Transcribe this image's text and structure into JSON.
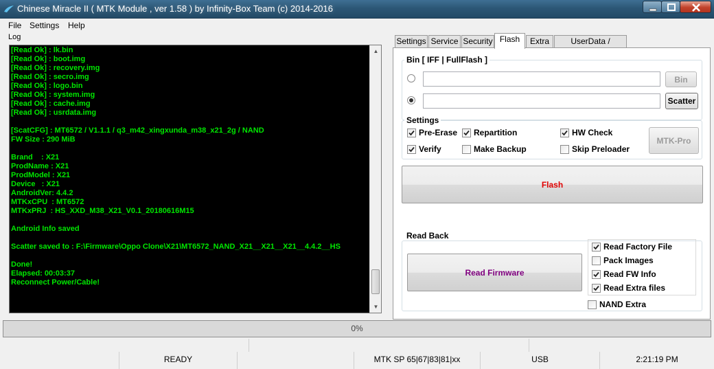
{
  "window": {
    "title": "Chinese Miracle II ( MTK Module , ver 1.58 ) by Infinity-Box Team (c) 2014-2016",
    "controls": [
      "minimize-icon",
      "maximize-icon",
      "close-icon"
    ],
    "accent_color": "#2c5776"
  },
  "menu": [
    "File",
    "Settings",
    "Help"
  ],
  "log": {
    "label": "Log",
    "text_color": "#00e600",
    "lines": [
      "[Read Ok] : lk.bin",
      "[Read Ok] : boot.img",
      "[Read Ok] : recovery.img",
      "[Read Ok] : secro.img",
      "[Read Ok] : logo.bin",
      "[Read Ok] : system.img",
      "[Read Ok] : cache.img",
      "[Read Ok] : usrdata.img",
      "",
      "[ScatCFG] : MT6572 / V1.1.1 / q3_m42_xingxunda_m38_x21_2g / NAND",
      "FW Size : 290 MiB",
      "",
      "Brand    : X21",
      "ProdName : X21",
      "ProdModel : X21",
      "Device   : X21",
      "AndroidVer: 4.4.2",
      "MTKxCPU  : MT6572",
      "MTKxPRJ  : HS_XXD_M38_X21_V0.1_20180616M15",
      "",
      "Android Info saved",
      "",
      "Scatter saved to : F:\\Firmware\\Oppo Clone\\X21\\MT6572_NAND_X21__X21__X21__4.4.2__HS",
      "",
      "Done!",
      "Elapsed: 00:03:37",
      "Reconnect Power/Cable!"
    ]
  },
  "tabs": [
    "Settings",
    "Service",
    "Security",
    "Flash",
    "Extra",
    "UserData / Forensic"
  ],
  "active_tab": "Flash",
  "flash": {
    "bin_group_title": "Bin  [ IFF | FullFlash ]",
    "bin_radio_selected": false,
    "scatter_radio_selected": true,
    "bin_path": "",
    "scatter_path": "",
    "bin_button": "Bin",
    "scatter_button": "Scatter",
    "settings_title": "Settings",
    "options": [
      {
        "label": "Pre-Erase",
        "checked": true
      },
      {
        "label": "Repartition",
        "checked": true
      },
      {
        "label": "HW Check",
        "checked": true
      },
      {
        "label": "Verify",
        "checked": true
      },
      {
        "label": "Make Backup",
        "checked": false
      },
      {
        "label": "Skip Preloader",
        "checked": false
      }
    ],
    "mtk_pro_button": "MTK-Pro",
    "flash_button": "Flash",
    "flash_button_color": "#e00000"
  },
  "readback": {
    "title": "Read Back",
    "read_button": "Read Firmware",
    "read_button_color": "#800080",
    "options": [
      {
        "label": "Read Factory File",
        "checked": true
      },
      {
        "label": "Pack Images",
        "checked": false
      },
      {
        "label": "Read FW Info",
        "checked": true
      },
      {
        "label": "Read Extra files",
        "checked": true
      }
    ],
    "nand_extra": {
      "label": "NAND Extra",
      "checked": false
    }
  },
  "progress": {
    "value": 0,
    "label": "0%"
  },
  "status": {
    "state": "READY",
    "sp": "MTK SP 65|67|83|81|xx",
    "port": "USB",
    "time": "2:21:19 PM"
  }
}
